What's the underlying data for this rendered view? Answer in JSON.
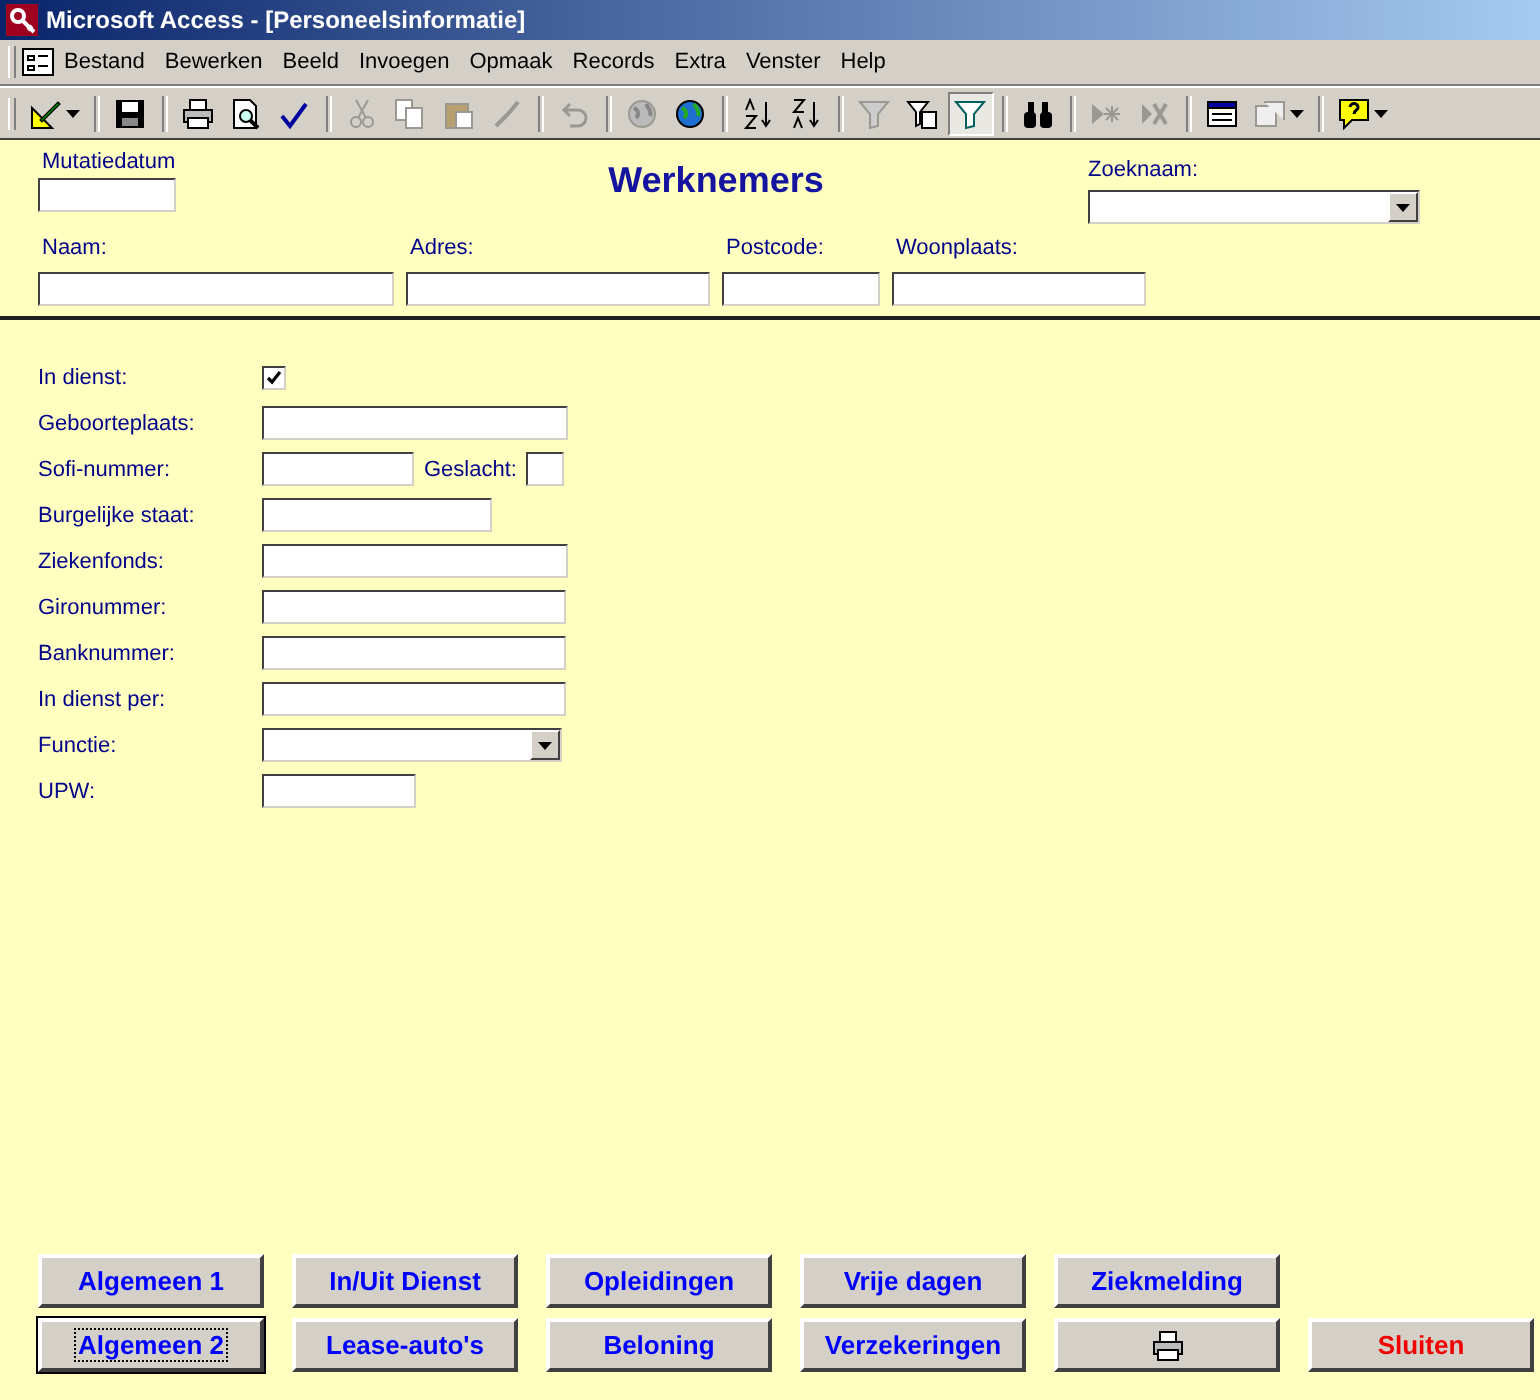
{
  "window": {
    "title": "Microsoft Access - [Personeelsinformatie]"
  },
  "menu": [
    "Bestand",
    "Bewerken",
    "Beeld",
    "Invoegen",
    "Opmaak",
    "Records",
    "Extra",
    "Venster",
    "Help"
  ],
  "toolbar": [
    {
      "kind": "design",
      "disabled": false,
      "selected": false,
      "dropdown": true
    },
    {
      "kind": "separator"
    },
    {
      "kind": "save",
      "disabled": false,
      "selected": false,
      "dropdown": false
    },
    {
      "kind": "separator"
    },
    {
      "kind": "print",
      "disabled": false,
      "selected": false,
      "dropdown": false
    },
    {
      "kind": "preview",
      "disabled": false,
      "selected": false,
      "dropdown": false
    },
    {
      "kind": "spelling",
      "disabled": false,
      "selected": false,
      "dropdown": false
    },
    {
      "kind": "separator"
    },
    {
      "kind": "cut",
      "disabled": true,
      "selected": false,
      "dropdown": false
    },
    {
      "kind": "copy",
      "disabled": true,
      "selected": false,
      "dropdown": false
    },
    {
      "kind": "paste",
      "disabled": true,
      "selected": false,
      "dropdown": false
    },
    {
      "kind": "brush",
      "disabled": true,
      "selected": false,
      "dropdown": false
    },
    {
      "kind": "separator"
    },
    {
      "kind": "undo",
      "disabled": true,
      "selected": false,
      "dropdown": false
    },
    {
      "kind": "separator"
    },
    {
      "kind": "globe",
      "disabled": true,
      "selected": false,
      "dropdown": false
    },
    {
      "kind": "globe",
      "disabled": false,
      "selected": false,
      "dropdown": false
    },
    {
      "kind": "separator"
    },
    {
      "kind": "sortasc",
      "disabled": false,
      "selected": false,
      "dropdown": false
    },
    {
      "kind": "sortdesc",
      "disabled": false,
      "selected": false,
      "dropdown": false
    },
    {
      "kind": "separator"
    },
    {
      "kind": "filter",
      "disabled": true,
      "selected": false,
      "dropdown": false
    },
    {
      "kind": "formfilter",
      "disabled": false,
      "selected": false,
      "dropdown": false
    },
    {
      "kind": "filter",
      "disabled": false,
      "selected": true,
      "dropdown": false
    },
    {
      "kind": "separator"
    },
    {
      "kind": "find",
      "disabled": false,
      "selected": false,
      "dropdown": false
    },
    {
      "kind": "separator"
    },
    {
      "kind": "newrecord",
      "disabled": true,
      "selected": false,
      "dropdown": false
    },
    {
      "kind": "deleterecord",
      "disabled": true,
      "selected": false,
      "dropdown": false
    },
    {
      "kind": "separator"
    },
    {
      "kind": "window",
      "disabled": false,
      "selected": false,
      "dropdown": false
    },
    {
      "kind": "newobject",
      "disabled": true,
      "selected": false,
      "dropdown": true
    },
    {
      "kind": "separator"
    },
    {
      "kind": "help",
      "disabled": false,
      "selected": false,
      "dropdown": true
    }
  ],
  "form": {
    "title": "Werknemers",
    "mutation": {
      "label": "Mutatiedatum",
      "kind": "text"
    },
    "search": {
      "label": "Zoeknaam:",
      "kind": "combo"
    },
    "header_fields": [
      {
        "label": "Naam:",
        "kind": "text"
      },
      {
        "label": "Adres:",
        "kind": "text"
      },
      {
        "label": "Postcode:",
        "kind": "text"
      },
      {
        "label": "Woonplaats:",
        "kind": "text"
      }
    ],
    "detail_fields": [
      {
        "label": "In dienst:",
        "kind": "checkbox",
        "checked": true
      },
      {
        "label": "Geboorteplaats:",
        "kind": "text"
      },
      {
        "label": "Sofi-nummer:",
        "kind": "text",
        "side": {
          "label": "Geslacht:",
          "kind": "text"
        }
      },
      {
        "label": "Burgelijke staat:",
        "kind": "text"
      },
      {
        "label": "Ziekenfonds:",
        "kind": "text"
      },
      {
        "label": "Gironummer:",
        "kind": "text"
      },
      {
        "label": "Banknummer:",
        "kind": "text"
      },
      {
        "label": "In dienst per:",
        "kind": "text"
      },
      {
        "label": "Functie:",
        "kind": "combo"
      },
      {
        "label": "UPW:",
        "kind": "text"
      }
    ],
    "button_rows": [
      [
        {
          "label": "Algemeen 1",
          "kind": "text",
          "focused": false
        },
        {
          "label": "In/Uit Dienst",
          "kind": "text",
          "focused": false
        },
        {
          "label": "Opleidingen",
          "kind": "text",
          "focused": false
        },
        {
          "label": "Vrije dagen",
          "kind": "text",
          "focused": false
        },
        {
          "label": "Ziekmelding",
          "kind": "text",
          "focused": false
        }
      ],
      [
        {
          "label": "Algemeen 2",
          "kind": "text",
          "focused": true
        },
        {
          "label": "Lease-auto's",
          "kind": "text",
          "focused": false
        },
        {
          "label": "Beloning",
          "kind": "text",
          "focused": false
        },
        {
          "label": "Verzekeringen",
          "kind": "text",
          "focused": false
        },
        {
          "kind": "print",
          "focused": false
        },
        {
          "label": "Sluiten",
          "kind": "close",
          "focused": false
        }
      ]
    ]
  }
}
